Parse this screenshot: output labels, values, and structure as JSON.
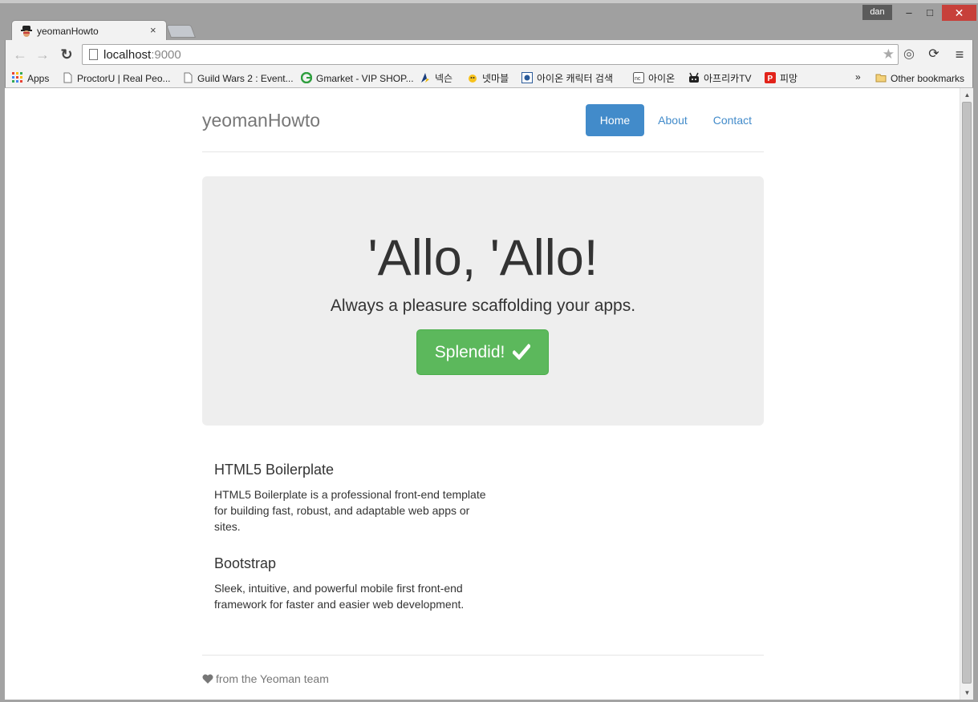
{
  "window": {
    "user_badge": "dan",
    "controls": {
      "minimize": "–",
      "maximize": "□",
      "close": "✕"
    }
  },
  "tab": {
    "title": "yeomanHowto",
    "close": "×"
  },
  "toolbar": {
    "url_host": "localhost",
    "url_port": ":9000"
  },
  "bookmarks": {
    "items": [
      {
        "label": "Apps",
        "icon": "apps-grid-icon"
      },
      {
        "label": "ProctorU | Real Peo...",
        "icon": "page-icon"
      },
      {
        "label": "Guild Wars 2 : Event...",
        "icon": "page-icon"
      },
      {
        "label": "Gmarket - VIP SHOP...",
        "icon": "gmarket-icon"
      },
      {
        "label": "넥슨",
        "icon": "nexon-icon"
      },
      {
        "label": "넷마블",
        "icon": "netmarble-icon"
      },
      {
        "label": "아이온 캐릭터 검색",
        "icon": "aion-icon"
      },
      {
        "label": "아이온",
        "icon": "nc-icon"
      },
      {
        "label": "아프리카TV",
        "icon": "afreecatv-icon"
      },
      {
        "label": "피망",
        "icon": "pmang-icon"
      }
    ],
    "more": "»",
    "other": "Other bookmarks"
  },
  "page": {
    "brand": "yeomanHowto",
    "nav": [
      {
        "label": "Home",
        "active": true
      },
      {
        "label": "About",
        "active": false
      },
      {
        "label": "Contact",
        "active": false
      }
    ],
    "jumbotron": {
      "title": "'Allo, 'Allo!",
      "lead": "Always a pleasure scaffolding your apps.",
      "button": "Splendid!"
    },
    "features": [
      {
        "title": "HTML5 Boilerplate",
        "text": "HTML5 Boilerplate is a professional front-end template for building fast, robust, and adaptable web apps or sites."
      },
      {
        "title": "Bootstrap",
        "text": "Sleek, intuitive, and powerful mobile first front-end framework for faster and easier web development."
      }
    ],
    "footer": "from the Yeoman team"
  },
  "colors": {
    "primary": "#428bca",
    "success": "#5cb85c",
    "jumbotron_bg": "#eeeeee",
    "muted": "#777777"
  }
}
